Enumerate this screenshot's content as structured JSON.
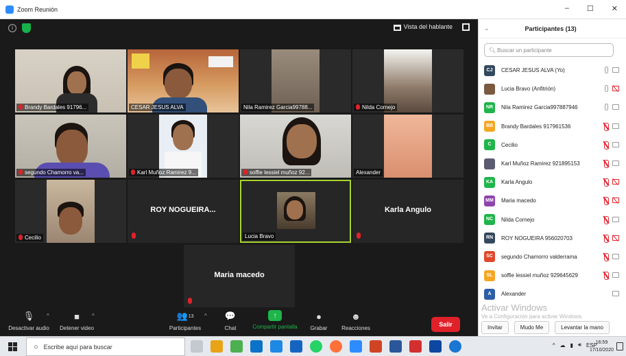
{
  "window": {
    "title": "Zoom Reunión",
    "controls": [
      "–",
      "☐",
      "✕"
    ]
  },
  "meeting": {
    "top": {
      "speaker_view_label": "Vista del hablante"
    },
    "tiles": [
      {
        "name": "Brandy Bardales 91796...",
        "muted": true,
        "video": true
      },
      {
        "name": "CESAR JESUS ALVA",
        "muted": false,
        "video": true
      },
      {
        "name": "Nila Ramirez Garcia99788...",
        "muted": false,
        "video": true
      },
      {
        "name": "Nilda Cornejo",
        "muted": true,
        "video": true
      },
      {
        "name": "segundo Chamorro va...",
        "muted": true,
        "video": true
      },
      {
        "name": "Karl Muñoz Ramirez 9...",
        "muted": true,
        "video": true
      },
      {
        "name": "soffie lessiel muñoz 92...",
        "muted": true,
        "video": true
      },
      {
        "name": "Alexander",
        "muted": false,
        "video": true
      },
      {
        "name": "Cecilio",
        "muted": true,
        "video": true
      },
      {
        "name": "ROY NOGUEIRA...",
        "muted": true,
        "video": false
      },
      {
        "name": "Lucia Bravo",
        "muted": false,
        "video": true,
        "active": true
      },
      {
        "name": "Karla Angulo",
        "muted": true,
        "video": false
      },
      {
        "name": "Maria macedo",
        "muted": true,
        "video": false
      }
    ],
    "toolbar": {
      "mute": "Desactivar audio",
      "video": "Detener video",
      "participants": "Participantes",
      "participants_count": "13",
      "chat": "Chat",
      "share": "Compartir pantalla",
      "record": "Grabar",
      "reactions": "Reacciones",
      "leave": "Salir"
    }
  },
  "panel": {
    "title": "Participantes (13)",
    "search_placeholder": "Buscar un participante",
    "participants": [
      {
        "initials": "CJ",
        "color": "#34495e",
        "name": "CESAR JESUS ALVA (Yo)",
        "mic": "on",
        "cam": "on"
      },
      {
        "initials": "",
        "color": "#7a5a40",
        "name": "Lucia Bravo (Anfitrión)",
        "mic": "on",
        "cam": "off"
      },
      {
        "initials": "NR",
        "color": "#1fb54a",
        "name": "Nila Ramirez Garcia997887946",
        "mic": "on",
        "cam": "on"
      },
      {
        "initials": "BB",
        "color": "#f5a623",
        "name": "Brandy Bardales 917961536",
        "mic": "off",
        "cam": "on"
      },
      {
        "initials": "C",
        "color": "#1fb54a",
        "name": "Cecilio",
        "mic": "off",
        "cam": "on"
      },
      {
        "initials": "",
        "color": "#5b5b72",
        "name": "Karl Muñoz Ramirez 921895153",
        "mic": "off",
        "cam": "on"
      },
      {
        "initials": "KA",
        "color": "#1fb54a",
        "name": "Karla Angulo",
        "mic": "off",
        "cam": "off"
      },
      {
        "initials": "MM",
        "color": "#8e44ad",
        "name": "Maria macedo",
        "mic": "off",
        "cam": "off"
      },
      {
        "initials": "NC",
        "color": "#1fb54a",
        "name": "Nilda Cornejo",
        "mic": "off",
        "cam": "on"
      },
      {
        "initials": "RN",
        "color": "#34495e",
        "name": "ROY NOGUEIRA 956020703",
        "mic": "off",
        "cam": "off"
      },
      {
        "initials": "SC",
        "color": "#e0472a",
        "name": "segundo Chamorro valderrama",
        "mic": "off",
        "cam": "on"
      },
      {
        "initials": "SL",
        "color": "#f5a623",
        "name": "soffie lessiel muñoz 929645629",
        "mic": "off",
        "cam": "on"
      },
      {
        "initials": "A",
        "color": "#2d5fa8",
        "name": "Alexander",
        "mic": "none",
        "cam": "on"
      }
    ],
    "activate_title": "Activar Windows",
    "activate_sub": "Ve a Configuración para activar Windows.",
    "footer": {
      "invite": "Invitar",
      "mute_me": "Mudo Me",
      "raise_hand": "Levantar la mano"
    }
  },
  "taskbar": {
    "search_placeholder": "Escribe aquí para buscar",
    "language": "ESP",
    "time": "16:59",
    "date": "17/10/2020"
  }
}
